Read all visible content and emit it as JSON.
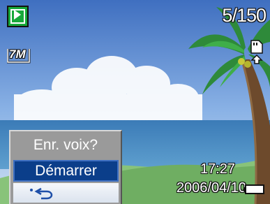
{
  "mode": {
    "icon": "playback-icon"
  },
  "counter": "5/150",
  "resolution": {
    "label": "7M",
    "icon": "resolution-icon"
  },
  "memory": {
    "icon": "internal-memory-icon"
  },
  "menu": {
    "title": "Enr. voix?",
    "items": [
      {
        "label": "Démarrer",
        "selected": true
      },
      {
        "label": "",
        "icon": "back-arrow-icon",
        "selected": false
      }
    ]
  },
  "timestamp": {
    "time": "17:27",
    "date": "2006/04/10"
  },
  "battery": {
    "icon": "battery-icon",
    "level": "full"
  },
  "colors": {
    "menu_highlight": "#0b3e8a",
    "menu_bg": "#9a9a9a",
    "mode_icon": "#17a83a"
  }
}
